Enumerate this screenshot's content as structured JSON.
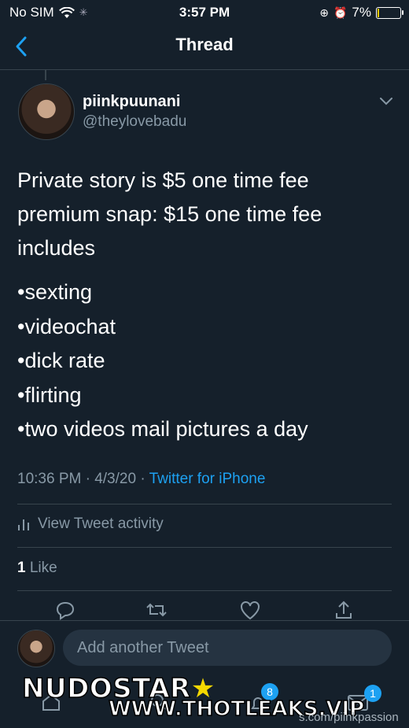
{
  "status_bar": {
    "carrier": "No SIM",
    "time": "3:57 PM",
    "battery": "7%",
    "battery_level": 0.07
  },
  "nav": {
    "title": "Thread"
  },
  "tweet": {
    "name": "piinkpuunani",
    "handle": "@theylovebadu",
    "lines": [
      "Private story is $5 one time fee",
      "premium snap: $15 one time fee",
      "includes"
    ],
    "list": [
      "•sexting",
      "•videochat",
      "•dick rate",
      "•flirting",
      "•two videos mail pictures a day"
    ],
    "timestamp": "10:36 PM · 4/3/20 · ",
    "source": "Twitter for iPhone",
    "activity": "View Tweet activity",
    "likes_count": "1",
    "likes_label": " Like"
  },
  "composer": {
    "placeholder": "Add another Tweet"
  },
  "tabbar": {
    "notifications_badge": "8",
    "messages_badge": "1"
  },
  "watermark": {
    "brand": "NUDOSTAR",
    "site": "WWW.THOTLEAKS.VIP",
    "handle": "s.com/piinkpassion"
  },
  "colors": {
    "background": "#15202b",
    "accent": "#1da1f2",
    "secondary_text": "#8899a6",
    "divider": "#38444d"
  }
}
